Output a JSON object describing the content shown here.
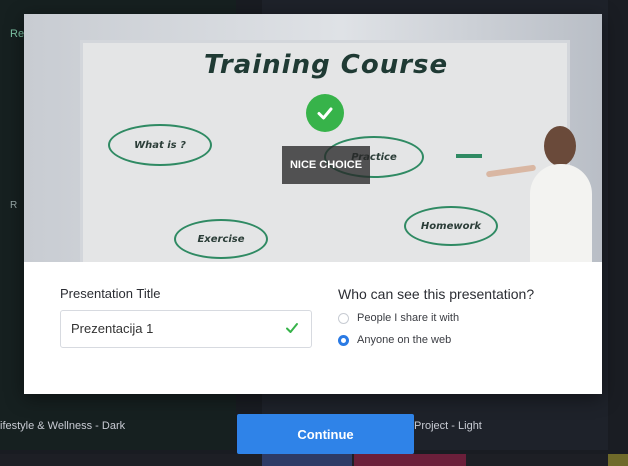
{
  "background": {
    "left_card_label": "ifestyle & Wellness - Dark",
    "right_card_label": "Project - Light",
    "edge_text_1": "Re",
    "edge_text_2": "R"
  },
  "preview": {
    "board_title": "Training Course",
    "bubbles": [
      "What is ?",
      "Exercise",
      "Practice",
      "Homework"
    ],
    "selected_badge": "NICE CHOICE",
    "check_icon": "check-circle-icon"
  },
  "form": {
    "title_label": "Presentation Title",
    "title_value": "Prezentacija 1",
    "visibility_label": "Who can see this presentation?",
    "options": [
      {
        "label": "People I share it with",
        "selected": false
      },
      {
        "label": "Anyone on the web",
        "selected": true
      }
    ]
  },
  "actions": {
    "continue_label": "Continue"
  },
  "colors": {
    "accent": "#2f83e8",
    "success": "#37b34a"
  }
}
